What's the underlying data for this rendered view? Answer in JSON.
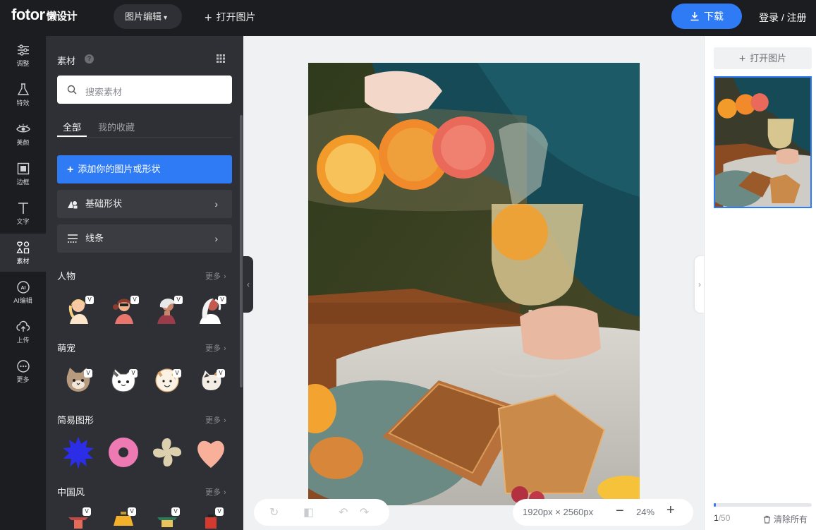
{
  "topbar": {
    "logo": "fotor",
    "logo_sub": "懒设计",
    "edit_menu": "图片编辑",
    "open_image": "打开图片",
    "download": "下载",
    "login": "登录 / 注册"
  },
  "leftnav": [
    {
      "label": "调整",
      "icon": "sliders-icon"
    },
    {
      "label": "特效",
      "icon": "flask-icon"
    },
    {
      "label": "美颜",
      "icon": "eye-icon"
    },
    {
      "label": "边框",
      "icon": "frame-icon"
    },
    {
      "label": "文字",
      "icon": "text-icon"
    },
    {
      "label": "素材",
      "icon": "shapes-icon"
    },
    {
      "label": "AI编辑",
      "icon": "ai-icon"
    },
    {
      "label": "上传",
      "icon": "upload-icon"
    },
    {
      "label": "更多",
      "icon": "more-icon"
    }
  ],
  "panel": {
    "title": "素材",
    "help": "?",
    "search_placeholder": "搜索素材",
    "tab_all": "全部",
    "tab_fav": "我的收藏",
    "add_button": "添加你的图片或形状",
    "basic_shapes": "基础形状",
    "lines": "线条",
    "sections": [
      {
        "title": "人物",
        "more": "更多"
      },
      {
        "title": "萌宠",
        "more": "更多"
      },
      {
        "title": "简易图形",
        "more": "更多"
      },
      {
        "title": "中国风",
        "more": "更多"
      }
    ],
    "badge": "V"
  },
  "canvas": {
    "dimensions": "1920px × 2560px",
    "zoom": "24%"
  },
  "right": {
    "open_image": "打开图片",
    "page_current": "1",
    "page_total": "/50",
    "progress": 0.02,
    "clear_all": "清除所有"
  },
  "colors": {
    "accent": "#2f7bf5",
    "dark_bg": "#1c1d21",
    "panel_bg": "#2e3035"
  }
}
